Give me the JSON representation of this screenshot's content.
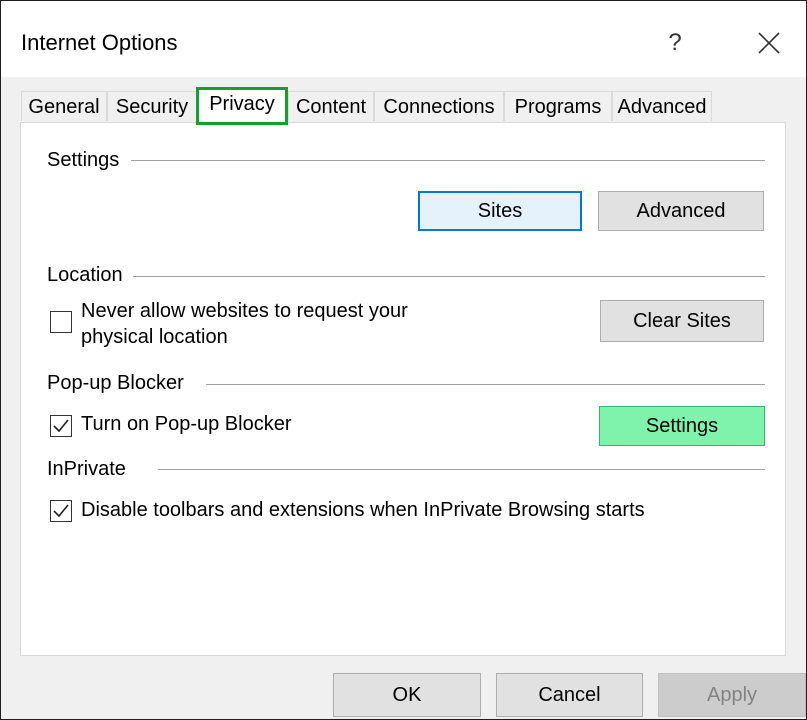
{
  "window": {
    "title": "Internet Options",
    "help_label": "?",
    "close_icon": "close-icon"
  },
  "tabs": [
    {
      "label": "General"
    },
    {
      "label": "Security"
    },
    {
      "label": "Privacy",
      "active": true
    },
    {
      "label": "Content"
    },
    {
      "label": "Connections"
    },
    {
      "label": "Programs"
    },
    {
      "label": "Advanced"
    }
  ],
  "settings": {
    "group_label": "Settings",
    "sites_button": "Sites",
    "advanced_button": "Advanced"
  },
  "location": {
    "group_label": "Location",
    "never_allow_line1": "Never allow websites to request your",
    "never_allow_line2": "physical location",
    "never_allow_checked": false,
    "clear_sites_button": "Clear Sites"
  },
  "popup": {
    "group_label": "Pop-up Blocker",
    "turn_on_label": "Turn on Pop-up Blocker",
    "turn_on_checked": true,
    "settings_button": "Settings"
  },
  "inprivate": {
    "group_label": "InPrivate",
    "disable_label": "Disable toolbars and extensions when InPrivate Browsing starts",
    "disable_checked": true
  },
  "footer": {
    "ok": "OK",
    "cancel": "Cancel",
    "apply": "Apply"
  },
  "colors": {
    "highlight_tab_border": "#12a12f",
    "settings_button_bg": "#7ff3ab",
    "focus_border": "#0078d7"
  }
}
